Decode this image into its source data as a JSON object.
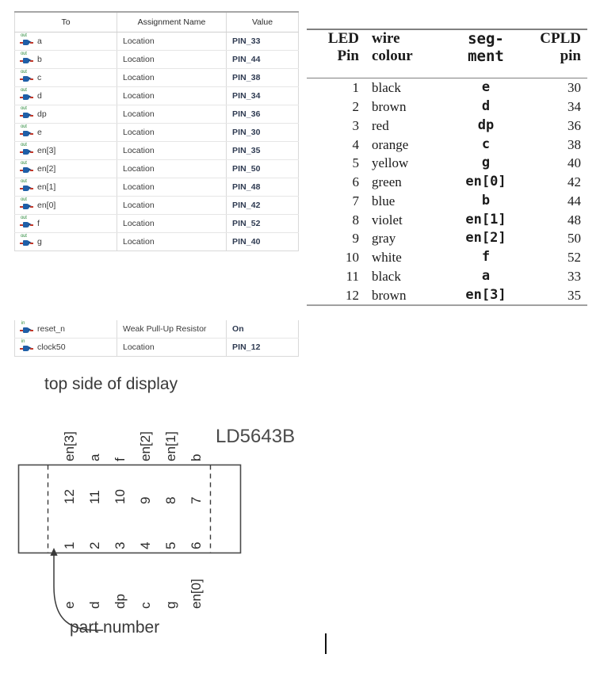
{
  "assignment_table": {
    "columns": [
      "To",
      "Assignment Name",
      "Value"
    ],
    "rows": [
      {
        "icon": "output-port-icon",
        "dir": "out",
        "to": "a",
        "name": "Location",
        "value": "PIN_33"
      },
      {
        "icon": "output-port-icon",
        "dir": "out",
        "to": "b",
        "name": "Location",
        "value": "PIN_44"
      },
      {
        "icon": "output-port-icon",
        "dir": "out",
        "to": "c",
        "name": "Location",
        "value": "PIN_38"
      },
      {
        "icon": "output-port-icon",
        "dir": "out",
        "to": "d",
        "name": "Location",
        "value": "PIN_34"
      },
      {
        "icon": "output-port-icon",
        "dir": "out",
        "to": "dp",
        "name": "Location",
        "value": "PIN_36"
      },
      {
        "icon": "output-port-icon",
        "dir": "out",
        "to": "e",
        "name": "Location",
        "value": "PIN_30"
      },
      {
        "icon": "output-port-icon",
        "dir": "out",
        "to": "en[3]",
        "name": "Location",
        "value": "PIN_35"
      },
      {
        "icon": "output-port-icon",
        "dir": "out",
        "to": "en[2]",
        "name": "Location",
        "value": "PIN_50"
      },
      {
        "icon": "output-port-icon",
        "dir": "out",
        "to": "en[1]",
        "name": "Location",
        "value": "PIN_48"
      },
      {
        "icon": "output-port-icon",
        "dir": "out",
        "to": "en[0]",
        "name": "Location",
        "value": "PIN_42"
      },
      {
        "icon": "output-port-icon",
        "dir": "out",
        "to": "f",
        "name": "Location",
        "value": "PIN_52"
      },
      {
        "icon": "output-port-icon",
        "dir": "out",
        "to": "g",
        "name": "Location",
        "value": "PIN_40"
      }
    ]
  },
  "input_table": {
    "rows": [
      {
        "icon": "input-port-icon",
        "dir": "in",
        "to": "reset_n",
        "name": "Weak Pull-Up Resistor",
        "value": "On"
      },
      {
        "icon": "input-port-icon",
        "dir": "in",
        "to": "clock50",
        "name": "Location",
        "value": "PIN_12"
      }
    ]
  },
  "wiring_table": {
    "headers": {
      "led_pin_l1": "LED",
      "led_pin_l2": "Pin",
      "wire_l1": "wire",
      "wire_l2": "colour",
      "seg_l1": "seg-",
      "seg_l2": "ment",
      "cpld_l1": "CPLD",
      "cpld_l2": "pin"
    },
    "rows": [
      {
        "led_pin": "1",
        "wire_colour": "black",
        "segment": "e",
        "cpld_pin": "30"
      },
      {
        "led_pin": "2",
        "wire_colour": "brown",
        "segment": "d",
        "cpld_pin": "34"
      },
      {
        "led_pin": "3",
        "wire_colour": "red",
        "segment": "dp",
        "cpld_pin": "36"
      },
      {
        "led_pin": "4",
        "wire_colour": "orange",
        "segment": "c",
        "cpld_pin": "38"
      },
      {
        "led_pin": "5",
        "wire_colour": "yellow",
        "segment": "g",
        "cpld_pin": "40"
      },
      {
        "led_pin": "6",
        "wire_colour": "green",
        "segment": "en[0]",
        "cpld_pin": "42"
      },
      {
        "led_pin": "7",
        "wire_colour": "blue",
        "segment": "b",
        "cpld_pin": "44"
      },
      {
        "led_pin": "8",
        "wire_colour": "violet",
        "segment": "en[1]",
        "cpld_pin": "48"
      },
      {
        "led_pin": "9",
        "wire_colour": "gray",
        "segment": "en[2]",
        "cpld_pin": "50"
      },
      {
        "led_pin": "10",
        "wire_colour": "white",
        "segment": "f",
        "cpld_pin": "52"
      },
      {
        "led_pin": "11",
        "wire_colour": "black",
        "segment": "a",
        "cpld_pin": "33"
      },
      {
        "led_pin": "12",
        "wire_colour": "brown",
        "segment": "en[3]",
        "cpld_pin": "35"
      }
    ]
  },
  "diagram": {
    "caption": "top side of display",
    "part_number_text": "LD5643B",
    "annotation": "part number",
    "top_pins": [
      {
        "num": "12",
        "signal": "en[3]"
      },
      {
        "num": "11",
        "signal": "a"
      },
      {
        "num": "10",
        "signal": "f"
      },
      {
        "num": "9",
        "signal": "en[2]"
      },
      {
        "num": "8",
        "signal": "en[1]"
      },
      {
        "num": "7",
        "signal": "b"
      }
    ],
    "bottom_pins": [
      {
        "num": "1",
        "signal": "e"
      },
      {
        "num": "2",
        "signal": "d"
      },
      {
        "num": "3",
        "signal": "dp"
      },
      {
        "num": "4",
        "signal": "c"
      },
      {
        "num": "5",
        "signal": "g"
      },
      {
        "num": "6",
        "signal": "en[0]"
      }
    ]
  },
  "colors": {
    "port_icon_body": "#1f5fa8",
    "port_icon_label": "#2e8b3d",
    "port_icon_wire": "#c0392b",
    "table_rule": "#808080",
    "grid_line": "#d9d9d9"
  }
}
